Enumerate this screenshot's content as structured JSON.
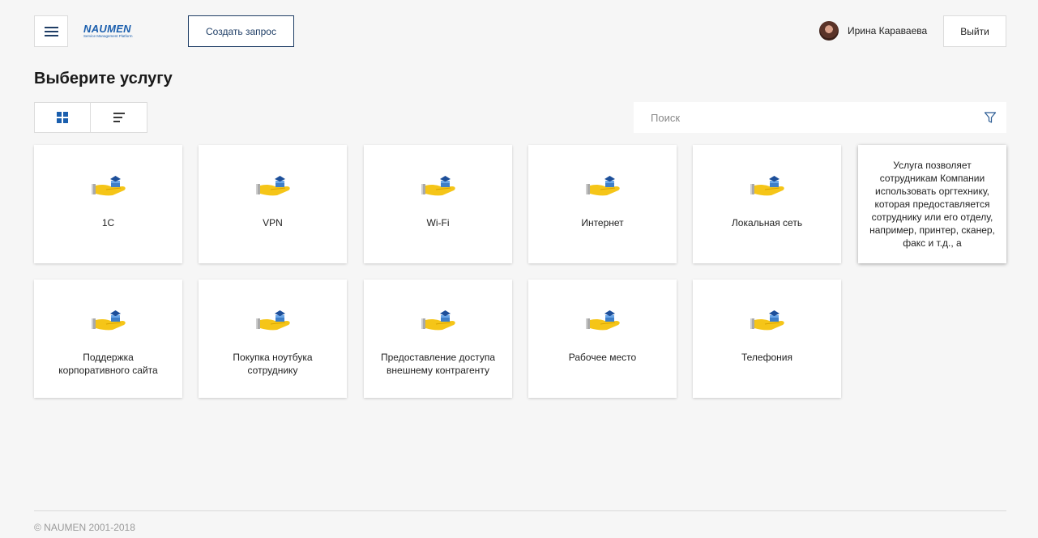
{
  "header": {
    "logo_main": "NAUMEN",
    "logo_sub": "Service Management Platform",
    "create_label": "Создать запрос",
    "user_name": "Ирина Караваева",
    "logout_label": "Выйти"
  },
  "page": {
    "title": "Выберите услугу"
  },
  "search": {
    "placeholder": "Поиск"
  },
  "services": [
    {
      "label": "1С"
    },
    {
      "label": "VPN"
    },
    {
      "label": "Wi-Fi"
    },
    {
      "label": "Интернет"
    },
    {
      "label": "Локальная сеть"
    },
    {
      "description": "Услуга позволяет сотрудникам Компании использовать оргтехнику, которая предоставляется сотруднику или его отделу, например, принтер, сканер, факс и т.д., а"
    },
    {
      "label": "Поддержка\nкорпоративного сайта"
    },
    {
      "label": "Покупка ноутбука\nсотруднику"
    },
    {
      "label": "Предоставление доступа\nвнешнему контрагенту"
    },
    {
      "label": "Рабочее место"
    },
    {
      "label": "Телефония"
    }
  ],
  "footer": {
    "copyright": "© NAUMEN 2001-2018"
  },
  "colors": {
    "accent": "#1f3e66",
    "background": "#f6f6f6",
    "brand": "#1b5fae"
  },
  "icons": {
    "menu": "hamburger-icon",
    "grid_view": "grid-icon",
    "list_view": "list-icon",
    "filter": "filter-icon",
    "service": "service-hand-icon"
  }
}
